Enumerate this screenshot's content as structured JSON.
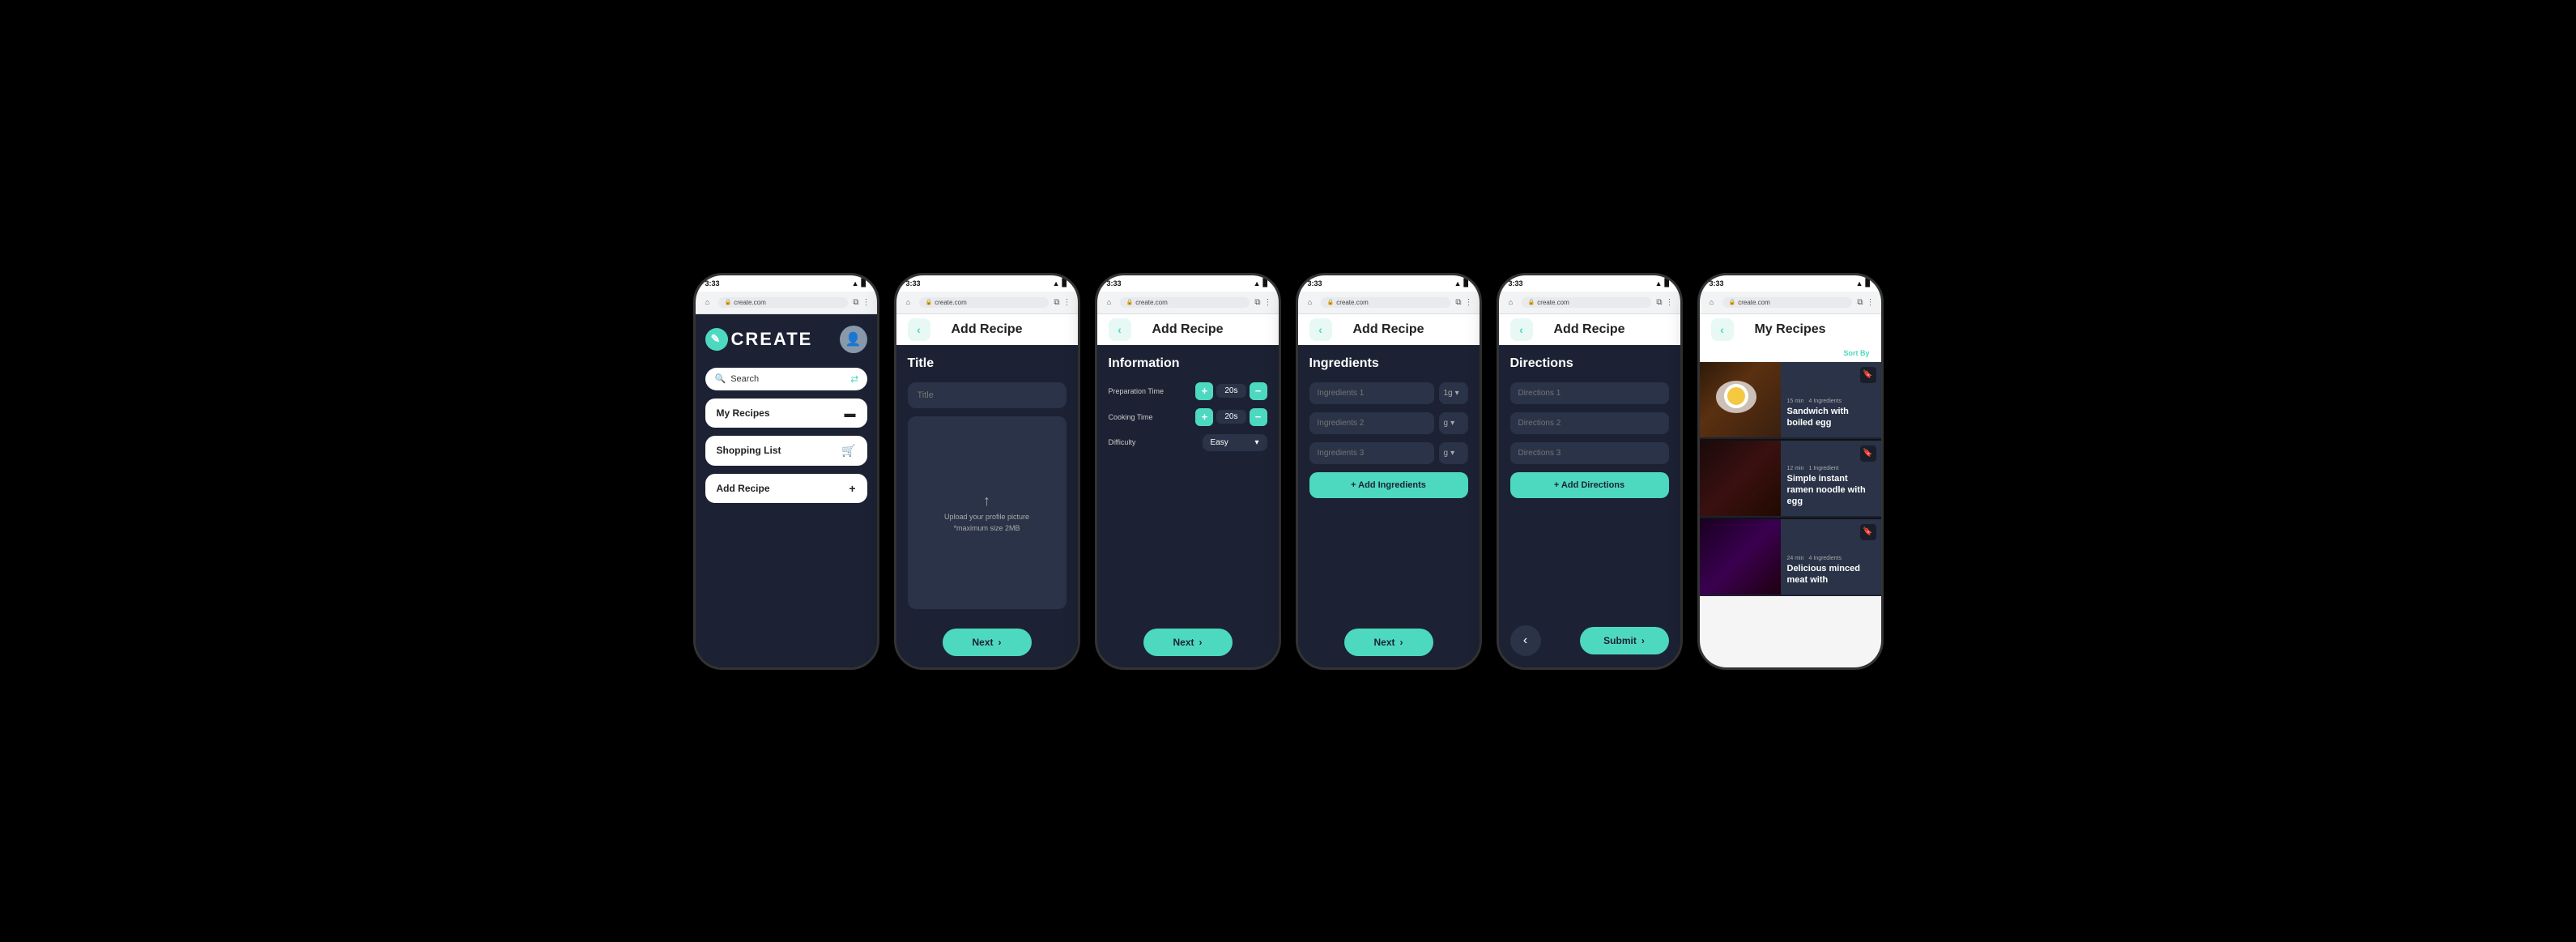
{
  "statusBar": {
    "time": "3:33",
    "icons": "▲ ◀ WiFi ▊"
  },
  "browserBar": {
    "url": "create.com",
    "lock": "🔒"
  },
  "phone1": {
    "logo": "CREATE",
    "searchPlaceholder": "Search",
    "navItems": [
      {
        "label": "My Recipes",
        "icon": "▬"
      },
      {
        "label": "Shopping List",
        "icon": "🛒"
      },
      {
        "label": "Add Recipe",
        "icon": "+"
      }
    ]
  },
  "phone2": {
    "headerTitle": "Add Recipe",
    "sectionTitle": "Title",
    "titlePlaceholder": "Title",
    "uploadText": "Upload your profile picture",
    "uploadSubtext": "*maximum size 2MB",
    "nextLabel": "Next"
  },
  "phone3": {
    "headerTitle": "Add Recipe",
    "sectionTitle": "Information",
    "prepLabel": "Preparation Time",
    "prepValue": "20s",
    "cookLabel": "Cooking Time",
    "cookValue": "20s",
    "diffLabel": "Difficulty",
    "diffValue": "Easy",
    "nextLabel": "Next"
  },
  "phone4": {
    "headerTitle": "Add Recipe",
    "sectionTitle": "Ingredients",
    "ingredients": [
      {
        "placeholder": "Ingredients 1",
        "qty": "1g"
      },
      {
        "placeholder": "Ingredients 2",
        "qty": "g"
      },
      {
        "placeholder": "Ingredients 3",
        "qty": "g"
      }
    ],
    "addLabel": "+ Add Ingredients",
    "nextLabel": "Next"
  },
  "phone5": {
    "headerTitle": "Add Recipe",
    "sectionTitle": "Directions",
    "directions": [
      {
        "placeholder": "Directions 1"
      },
      {
        "placeholder": "Directions 2"
      },
      {
        "placeholder": "Directions 3"
      }
    ],
    "addLabel": "+ Add Directions",
    "submitLabel": "Submit"
  },
  "phone6": {
    "headerTitle": "My Recipes",
    "sortLabel": "Sort By",
    "recipes": [
      {
        "name": "Sandwich with boiled egg",
        "time": "15 min",
        "ingredients": "4 Ingredients",
        "imageClass": "recipe-image-1"
      },
      {
        "name": "Simple instant ramen noodle with egg",
        "time": "12 min",
        "ingredients": "1 Ingredient",
        "imageClass": "recipe-image-2"
      },
      {
        "name": "Delicious minced meat with",
        "time": "24 min",
        "ingredients": "4 Ingredients",
        "imageClass": "recipe-image-3"
      }
    ]
  }
}
